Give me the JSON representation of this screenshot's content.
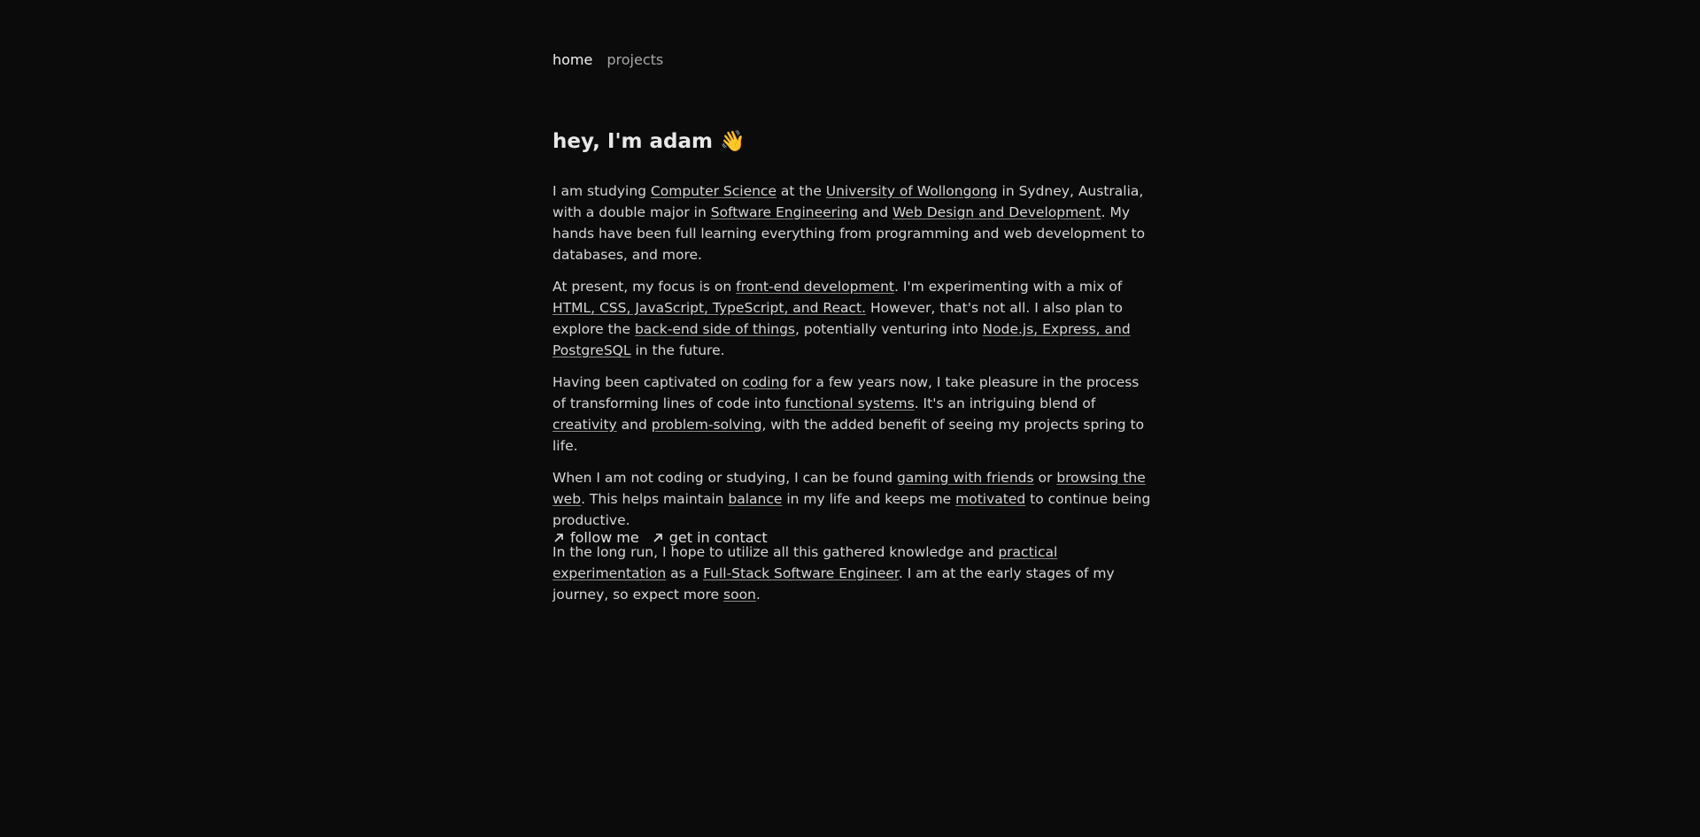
{
  "nav": {
    "home": "home",
    "projects": "projects"
  },
  "heading": {
    "text": "hey, I'm adam",
    "emoji": "👋"
  },
  "paragraphs": {
    "p1": {
      "t1": "I am studying ",
      "l1": "Computer Science",
      "t2": " at the ",
      "l2": "University of Wollongong",
      "t3": " in Sydney, Australia, with a double major in ",
      "l3": "Software Engineering",
      "t4": " and ",
      "l4": "Web Design and Development",
      "t5": ". My hands have been full learning everything from programming and web development to databases, and more."
    },
    "p2": {
      "t1": "At present, my focus is on ",
      "l1": "front-end development",
      "t2": ". I'm experimenting with a mix of ",
      "l2": "HTML, CSS, JavaScript, TypeScript, and React.",
      "t3": " However, that's not all. I also plan to explore the ",
      "l3": "back-end side of things",
      "t4": ", potentially venturing into ",
      "l4": "Node.js, Express, and PostgreSQL",
      "t5": " in the future."
    },
    "p3": {
      "t1": "Having been captivated on ",
      "l1": "coding",
      "t2": " for a few years now, I take pleasure in the process of transforming lines of code into ",
      "l2": "functional systems",
      "t3": ". It's an intriguing blend of ",
      "l3": "creativity",
      "t4": " and ",
      "l4": "problem-solving",
      "t5": ", with the added benefit of seeing my projects spring to life."
    },
    "p4": {
      "t1": "When I am not coding or studying, I can be found ",
      "l1": "gaming with friends",
      "t2": " or ",
      "l2": "browsing the web",
      "t3": ". This helps maintain ",
      "l3": "balance",
      "t4": " in my life and keeps me ",
      "l4": "motivated",
      "t5": " to continue being productive."
    },
    "p5": {
      "t1": "In the long run, I hope to utilize all this gathered knowledge and ",
      "l1": "practical experimentation",
      "t2": " as a ",
      "l2": "Full-Stack Software Engineer",
      "t3": ". I am at the early stages of my journey, so expect more ",
      "l3": "soon",
      "t4": "."
    }
  },
  "footer_links": {
    "follow": "follow me",
    "contact": "get in contact"
  },
  "icons": {
    "arrow": "arrow-up-right-icon"
  },
  "colors": {
    "background": "#0b0b0b",
    "text": "#d6d6d6"
  }
}
